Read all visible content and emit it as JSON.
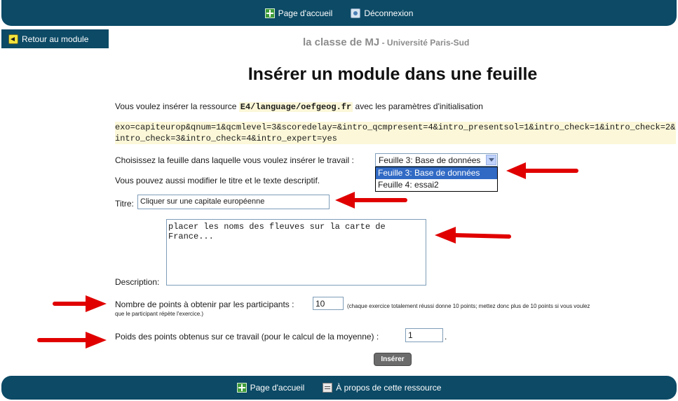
{
  "topnav": {
    "home": "Page d'accueil",
    "logout": "Déconnexion"
  },
  "back_button": "Retour au module",
  "site": {
    "name": "la classe de MJ",
    "separator": " - ",
    "institution": "Université Paris-Sud"
  },
  "page_title": "Insérer un module dans une feuille",
  "intro": {
    "before": "Vous voulez insérer la ressource ",
    "resource": "E4/language/oefgeog.fr",
    "after": " avec les paramètres d'initialisation"
  },
  "params": "exo=capiteurop&qnum=1&qcmlevel=3&scoredelay=&intro_qcmpresent=4&intro_presentsol=1&intro_check=1&intro_check=2&intro_check=3&intro_check=4&intro_expert=yes",
  "sheet": {
    "label": "Choisissez la feuille dans laquelle vous voulez insérer le travail :",
    "selected": "Feuille 3: Base de données",
    "options": [
      "Feuille 3: Base de données",
      "Feuille 4: essai2"
    ]
  },
  "modify_text": "Vous pouvez aussi modifier le titre et le texte descriptif.",
  "title_field": {
    "label": "Titre:",
    "value": "Cliquer sur une capitale européenne"
  },
  "description_field": {
    "label": "Description:",
    "value": "placer les noms des fleuves sur la carte de\nFrance..."
  },
  "points": {
    "label": "Nombre de points à obtenir par les participants :",
    "value": "10",
    "note_line1": "(chaque exercice totalement réussi donne 10 points; mettez donc plus de 10 points si vous voulez",
    "note_line2": "que le participant répète l'exercice.)"
  },
  "weight": {
    "label": "Poids des points obtenus sur ce travail (pour le calcul de la moyenne) :",
    "value": "1",
    "suffix": "."
  },
  "insert_button": "Insérer",
  "bottomnav": {
    "home": "Page d'accueil",
    "about": "À propos de cette ressource"
  },
  "colors": {
    "bar": "#0c4a66",
    "annotation_arrow": "#e00000",
    "selection": "#316ac5"
  }
}
